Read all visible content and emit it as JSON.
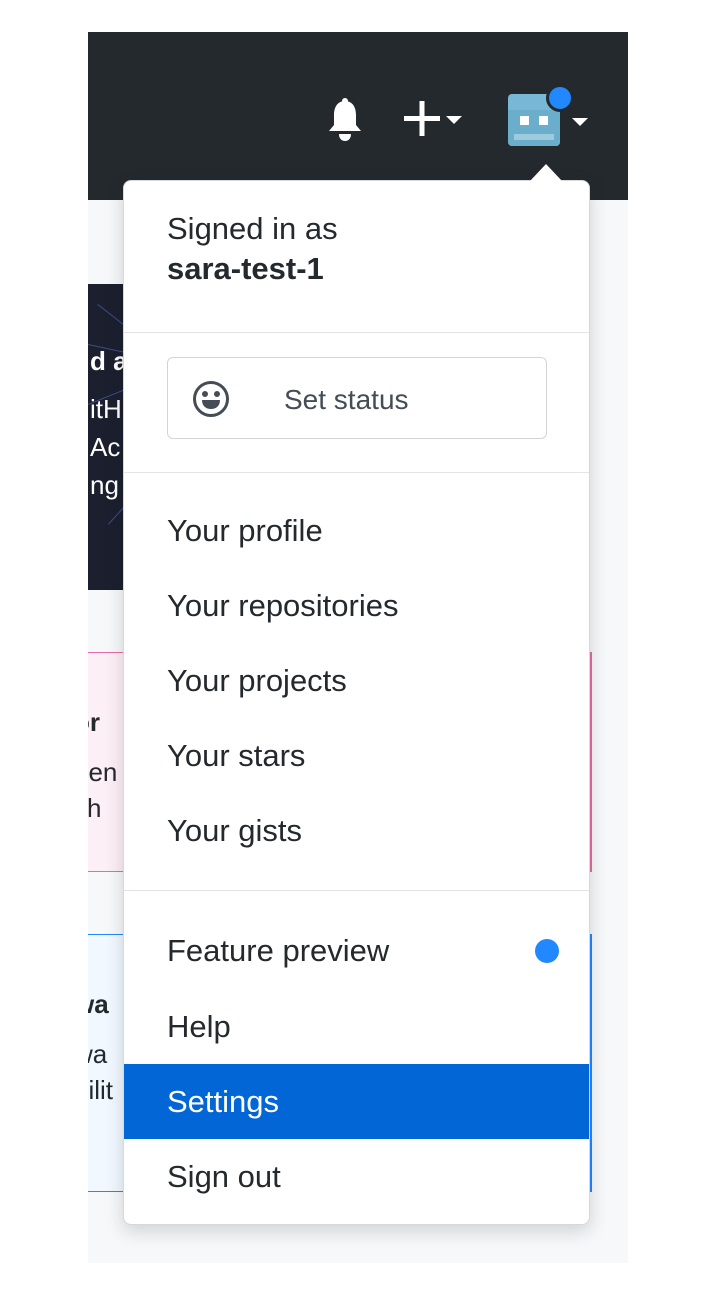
{
  "header": {
    "notifications_icon": "bell-icon",
    "create_icon": "plus-icon",
    "avatar_icon": "user-avatar",
    "colors": {
      "bar": "#24292e",
      "avatar": "#79b8d4",
      "indicator": "#2188ff"
    }
  },
  "background": {
    "hero_lines": [
      "d a",
      "itH",
      "Ac",
      "ng"
    ],
    "pink_card_lines": [
      "or",
      "gen",
      "ith"
    ],
    "blue_card_lines": [
      "wa",
      "wa",
      "bilit"
    ]
  },
  "dropdown": {
    "signed_in_label": "Signed in as",
    "username": "sara-test-1",
    "status_button": {
      "label": "Set status",
      "icon": "smiley-icon"
    },
    "profile_items": [
      {
        "label": "Your profile"
      },
      {
        "label": "Your repositories"
      },
      {
        "label": "Your projects"
      },
      {
        "label": "Your stars"
      },
      {
        "label": "Your gists"
      }
    ],
    "account_items": [
      {
        "label": "Feature preview",
        "has_indicator": true
      },
      {
        "label": "Help"
      },
      {
        "label": "Settings",
        "highlighted": true
      },
      {
        "label": "Sign out"
      }
    ],
    "colors": {
      "highlight": "#0366d6",
      "indicator": "#2188ff"
    }
  }
}
